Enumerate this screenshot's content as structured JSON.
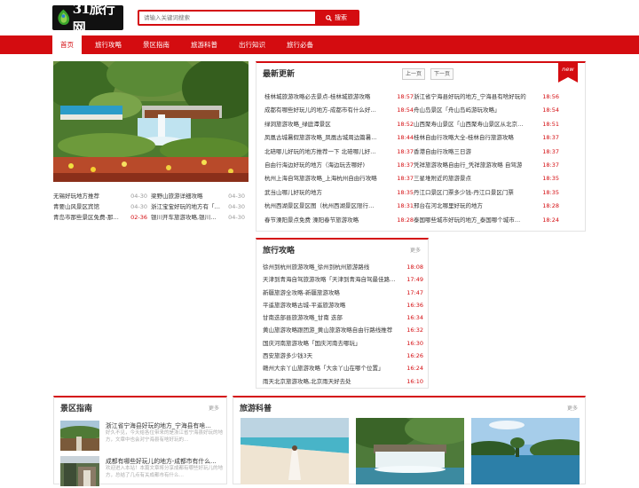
{
  "site": {
    "logo_text": "31旅行网",
    "search_placeholder": "请输入关键词搜索",
    "search_button": "搜索"
  },
  "nav": [
    "首页",
    "旅行攻略",
    "景区指南",
    "旅游科普",
    "出行知识",
    "旅行必备"
  ],
  "left_list": {
    "col1": [
      {
        "title": "无锡好玩地方推荐",
        "date": "04-30",
        "highlight": false
      },
      {
        "title": "青要山风景区宾馆",
        "date": "04-30",
        "highlight": false
      },
      {
        "title": "青岛市那些景区免费-那…",
        "date": "02-36",
        "highlight": true
      }
    ],
    "col2": [
      {
        "title": "梁野山旅游详细攻略",
        "date": "04-30",
        "highlight": false
      },
      {
        "title": "浙江宝宝好玩的地方有「…",
        "date": "04-30",
        "highlight": false
      },
      {
        "title": "银川开车旅游攻略,银川…",
        "date": "04-30",
        "highlight": false
      }
    ]
  },
  "updates": {
    "title": "最新更新",
    "prev": "上一页",
    "next": "下一页",
    "badge": "new",
    "left": [
      {
        "title": "桂林城旅游攻略必去景点-桂林城旅游攻略",
        "time": "18:57"
      },
      {
        "title": "成都有哪些好玩儿的地方-成都市有什么好…",
        "time": "18:54"
      },
      {
        "title": "绿洞旅游攻略_绿庭潭景区",
        "time": "18:52"
      },
      {
        "title": "凤凰古城暑假旅游攻略_凤凰古城周边篇暑…",
        "time": "18:44"
      },
      {
        "title": "北碚哪儿好玩的地方推荐一下 北碚哪儿好…",
        "time": "18:37"
      },
      {
        "title": "自由行海边好玩的地方（海边玩去哪好)",
        "time": "18:37"
      },
      {
        "title": "杭州上海自驾旅游攻略_上海杭州自由行攻略",
        "time": "18:37"
      },
      {
        "title": "武当山哪儿好玩的地方",
        "time": "18:35"
      },
      {
        "title": "杭州西湖景区景区图（杭州西湖景区限行…",
        "time": "18:31"
      },
      {
        "title": "春节溧阳景点免费 溧阳春节旅游攻略",
        "time": "18:28"
      }
    ],
    "right": [
      {
        "title": "浙江省宁海县好玩的地方_宁海县有啥好玩的",
        "time": "18:56"
      },
      {
        "title": "舟山岛景区「舟山岛屿游玩攻略」",
        "time": "18:54"
      },
      {
        "title": "山西聚寿山景区「山西聚寿山景区从北京…",
        "time": "18:51"
      },
      {
        "title": "桂林自由行攻略大全-桂林自行旅游攻略",
        "time": "18:37"
      },
      {
        "title": "香港自由行攻略三日游",
        "time": "18:37"
      },
      {
        "title": "凭祥旅游攻略自由行_凭祥旅游攻略 自驾游",
        "time": "18:37"
      },
      {
        "title": "三星堆附近的旅游景点",
        "time": "18:35"
      },
      {
        "title": "丹江口景区门票多少钱-丹江口景区门票",
        "time": "18:35"
      },
      {
        "title": "邢台在河北哪里好玩的地方",
        "time": "18:28"
      },
      {
        "title": "泰国哪些城市好玩的地方_泰国哪个城市…",
        "time": "18:24"
      }
    ]
  },
  "guides": {
    "title": "旅行攻略",
    "more": "更多",
    "items": [
      {
        "title": "徐州到杭州旅游攻略_徐州到杭州旅游路线",
        "time": "18:08"
      },
      {
        "title": "天津到青海自驾旅游攻略「天津到青海自驾最佳路…",
        "time": "17:49"
      },
      {
        "title": "新疆旅游全攻略-新疆旅游攻略",
        "time": "17:47"
      },
      {
        "title": "平遥旅游攻略古城-平遥旅游攻略",
        "time": "16:36"
      },
      {
        "title": "甘南迭部县旅游攻略_甘南 迭部",
        "time": "16:34"
      },
      {
        "title": "黄山旅游攻略跟团游_黄山旅游攻略自由行路线推荐",
        "time": "16:32"
      },
      {
        "title": "国庆河南旅游攻略「国庆河南去哪玩」",
        "time": "16:30"
      },
      {
        "title": "西安旅游多少钱3天",
        "time": "16:26"
      },
      {
        "title": "赣州大余丫山旅游攻略「大余丫山在哪个位置」",
        "time": "16:24"
      },
      {
        "title": "雨天北京旅游攻略,北京雨天好去处",
        "time": "16:10"
      }
    ]
  },
  "scenic": {
    "title": "景区指南",
    "more": "更多",
    "items": [
      {
        "title": "浙江省宁海县好玩的地方_宁海县有啥…",
        "desc": "好久不见，今天给各位带来的是浙江省宁海县好玩的地方，文章中也会对宁海县有啥好玩的…"
      },
      {
        "title": "成都有哪些好玩儿的地方-成都市有什么…",
        "desc": "欢迎进入本站！本篇文章将分享成都有哪些好玩儿的地方，总结了几点有关成都市有什么…"
      }
    ]
  },
  "popular": {
    "title": "旅游科普",
    "more": "更多"
  },
  "colors": {
    "brand": "#d40c10",
    "text": "#333333",
    "muted": "#999999"
  },
  "icons": [
    "logo-icon",
    "search-icon"
  ]
}
